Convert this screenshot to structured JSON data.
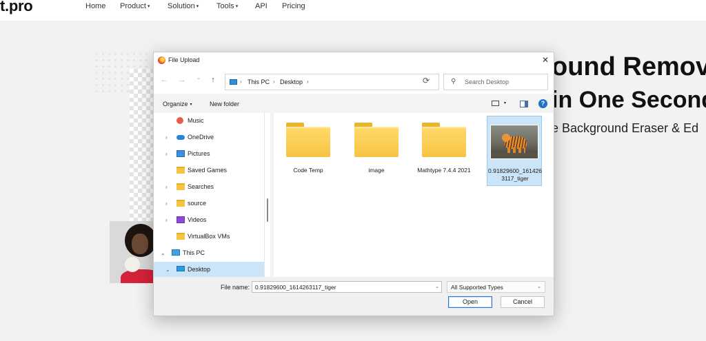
{
  "site": {
    "logo": "t.pro",
    "nav": [
      {
        "label": "Home",
        "caret": ""
      },
      {
        "label": "Product",
        "caret": "▾"
      },
      {
        "label": "Solution",
        "caret": "▾"
      },
      {
        "label": "Tools",
        "caret": "▾"
      },
      {
        "label": "API",
        "caret": ""
      },
      {
        "label": "Pricing",
        "caret": ""
      }
    ],
    "hero": {
      "line1": "ound Remova",
      "line2": "in One Second",
      "line3": "e Background Eraser & Ed"
    }
  },
  "dialog": {
    "title": "File Upload",
    "close_glyph": "✕",
    "nav_buttons": {
      "back": "←",
      "forward": "→",
      "recent": "⌄",
      "up": "↑"
    },
    "address": {
      "crumbs": [
        "This PC",
        "Desktop"
      ],
      "separator": "›",
      "dropdown": "⌄",
      "refresh": "⟳"
    },
    "search": {
      "icon": "⚲",
      "placeholder": "Search Desktop"
    },
    "commands": {
      "organize": "Organize",
      "new_folder": "New folder",
      "caret": "▾",
      "help": "?"
    },
    "tree": [
      {
        "label": "Music",
        "icon": "music-icon",
        "expand": ""
      },
      {
        "label": "OneDrive",
        "icon": "cloud-icon",
        "expand": "›"
      },
      {
        "label": "Pictures",
        "icon": "pictures-icon",
        "expand": "›"
      },
      {
        "label": "Saved Games",
        "icon": "folder-icon",
        "expand": ""
      },
      {
        "label": "Searches",
        "icon": "folder-icon",
        "expand": "›"
      },
      {
        "label": "source",
        "icon": "folder-icon",
        "expand": "›"
      },
      {
        "label": "Videos",
        "icon": "videos-icon",
        "expand": "›"
      },
      {
        "label": "VirtualBox VMs",
        "icon": "folder-icon",
        "expand": ""
      },
      {
        "label": "This PC",
        "icon": "pc-icon",
        "expand": "⌄"
      },
      {
        "label": "Desktop",
        "icon": "desktop-icon",
        "expand": "⌄",
        "selected": true
      }
    ],
    "files": [
      {
        "name": "Code Temp",
        "type": "folder"
      },
      {
        "name": "image",
        "type": "folder"
      },
      {
        "name": "Mathtype 7.4.4 2021",
        "type": "folder"
      },
      {
        "name": "0.91829600_1614263117_tiger",
        "type": "image",
        "selected": true
      }
    ],
    "footer": {
      "file_name_label": "File name:",
      "file_name_value": "0.91829600_1614263117_tiger",
      "type_value": "All Supported Types",
      "dropdown": "⌄",
      "open": "Open",
      "cancel": "Cancel"
    },
    "colors": {
      "selection": "#cce4f7",
      "accent": "#2b74c9"
    }
  }
}
